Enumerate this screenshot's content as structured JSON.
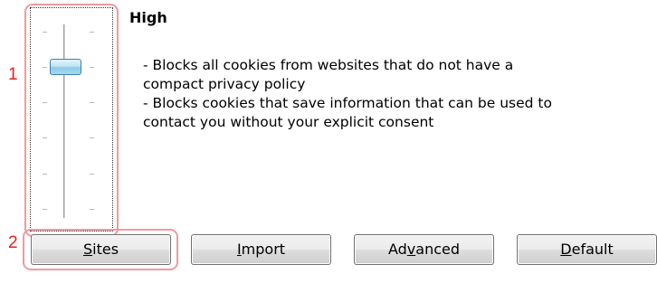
{
  "privacy": {
    "level": "High",
    "description": [
      "- Blocks all cookies from websites that do not have a",
      "compact privacy policy",
      "- Blocks cookies that save information that can be used to",
      "contact you without your explicit consent"
    ],
    "slider": {
      "position_index": 1,
      "levels": 6
    }
  },
  "buttons": {
    "sites": {
      "pre": "",
      "mnemonic": "S",
      "post": "ites"
    },
    "import": {
      "pre": "",
      "mnemonic": "I",
      "post": "mport"
    },
    "advanced": {
      "pre": "Ad",
      "mnemonic": "v",
      "post": "anced"
    },
    "default": {
      "pre": "",
      "mnemonic": "D",
      "post": "efault"
    }
  },
  "callouts": {
    "one": "1",
    "two": "2"
  },
  "colors": {
    "callout": "#e8211a",
    "highlight_box": "#f09aa0",
    "thumb": "#8fcbe8"
  }
}
